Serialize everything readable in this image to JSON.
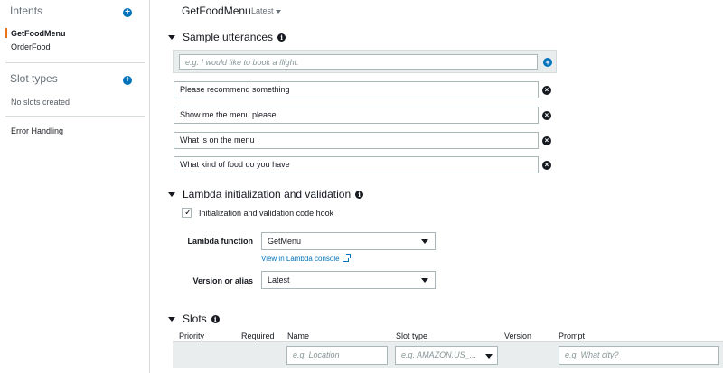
{
  "sidebar": {
    "intents_heading": "Intents",
    "intents": [
      {
        "label": "GetFoodMenu",
        "active": true
      },
      {
        "label": "OrderFood",
        "active": false
      }
    ],
    "slot_types_heading": "Slot types",
    "no_slots_text": "No slots created",
    "error_handling_label": "Error Handling"
  },
  "header": {
    "title": "GetFoodMenu",
    "version": "Latest"
  },
  "utterances": {
    "heading": "Sample utterances",
    "placeholder": "e.g. I would like to book a flight.",
    "items": [
      "Please recommend something",
      "Show me the menu please",
      "What is on the menu",
      "What kind of food do you have"
    ]
  },
  "lambda": {
    "heading": "Lambda initialization and validation",
    "checkbox_label": "Initialization and validation code hook",
    "checkbox_checked": true,
    "function_label": "Lambda function",
    "function_value": "GetMenu",
    "console_link": "View in Lambda console",
    "version_label": "Version or alias",
    "version_value": "Latest"
  },
  "slots": {
    "heading": "Slots",
    "columns": {
      "priority": "Priority",
      "required": "Required",
      "name": "Name",
      "slot_type": "Slot type",
      "version": "Version",
      "prompt": "Prompt"
    },
    "name_placeholder": "e.g. Location",
    "slot_type_placeholder": "e.g. AMAZON.US_...",
    "prompt_placeholder": "e.g. What city?"
  },
  "colors": {
    "accent": "#0073bb",
    "active_indicator": "#ec7211",
    "panel_gray": "#eaeded"
  },
  "icons": {
    "add": "plus-circle-icon",
    "remove": "x-circle-icon",
    "info": "info-icon",
    "collapse": "triangle-down-icon",
    "external": "external-link-icon"
  }
}
